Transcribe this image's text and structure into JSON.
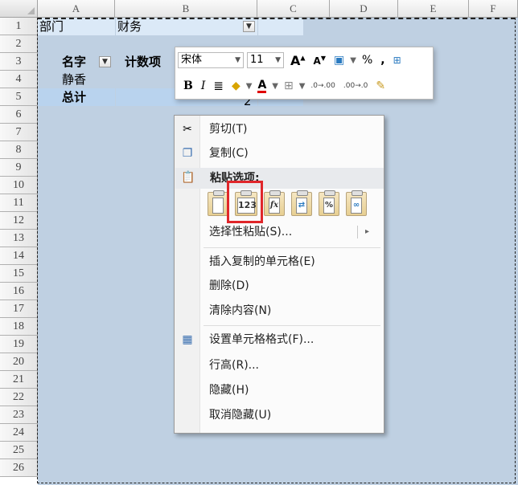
{
  "columns": [
    "A",
    "B",
    "C",
    "D",
    "E",
    "F"
  ],
  "rows": [
    "1",
    "2",
    "3",
    "4",
    "5",
    "6",
    "7",
    "8",
    "9",
    "10",
    "11",
    "12",
    "13",
    "14",
    "15",
    "16",
    "17",
    "18",
    "19",
    "20",
    "21",
    "22",
    "23",
    "24",
    "25",
    "26"
  ],
  "cells": {
    "a1": "部门",
    "b1": "财务",
    "a3": "名字",
    "b3": "计数项",
    "a4": "静香",
    "a5": "总计",
    "c5": "2"
  },
  "filter_icons": {
    "a3": "▼",
    "c1": "▼"
  },
  "mini_toolbar": {
    "font_name": "宋体",
    "font_size": "11",
    "grow_font": "A",
    "shrink_font": "A",
    "percent": "%",
    "comma": ",",
    "bold": "B",
    "italic": "I",
    "font_color": "A",
    "inc_decimal": ".0→.00",
    "dec_decimal": ".00→.0"
  },
  "context_menu": {
    "items": [
      {
        "label": "剪切(T)",
        "icon": "scissors-icon"
      },
      {
        "label": "复制(C)",
        "icon": "copy-icon"
      },
      {
        "label": "粘贴选项:",
        "icon": "clipboard-icon"
      },
      {
        "label": "选择性粘贴(S)...",
        "icon": ""
      },
      {
        "label": "插入复制的单元格(E)",
        "icon": ""
      },
      {
        "label": "删除(D)",
        "icon": ""
      },
      {
        "label": "清除内容(N)",
        "icon": ""
      },
      {
        "label": "设置单元格格式(F)...",
        "icon": "format-cells-icon"
      },
      {
        "label": "行高(R)...",
        "icon": ""
      },
      {
        "label": "隐藏(H)",
        "icon": ""
      },
      {
        "label": "取消隐藏(U)",
        "icon": ""
      }
    ],
    "paste_options": [
      {
        "name": "paste-icon",
        "glyph": ""
      },
      {
        "name": "paste-values-icon",
        "glyph": "123"
      },
      {
        "name": "paste-formulas-icon",
        "glyph": "fx"
      },
      {
        "name": "paste-transpose-icon",
        "glyph": "⇄"
      },
      {
        "name": "paste-formatting-icon",
        "glyph": "%"
      },
      {
        "name": "paste-link-icon",
        "glyph": "∞"
      }
    ],
    "submenu_arrow": "▸"
  },
  "colors": {
    "selection": "#cfe3f6",
    "highlight": "#e0262a",
    "font_color_bar": "#e00000"
  }
}
